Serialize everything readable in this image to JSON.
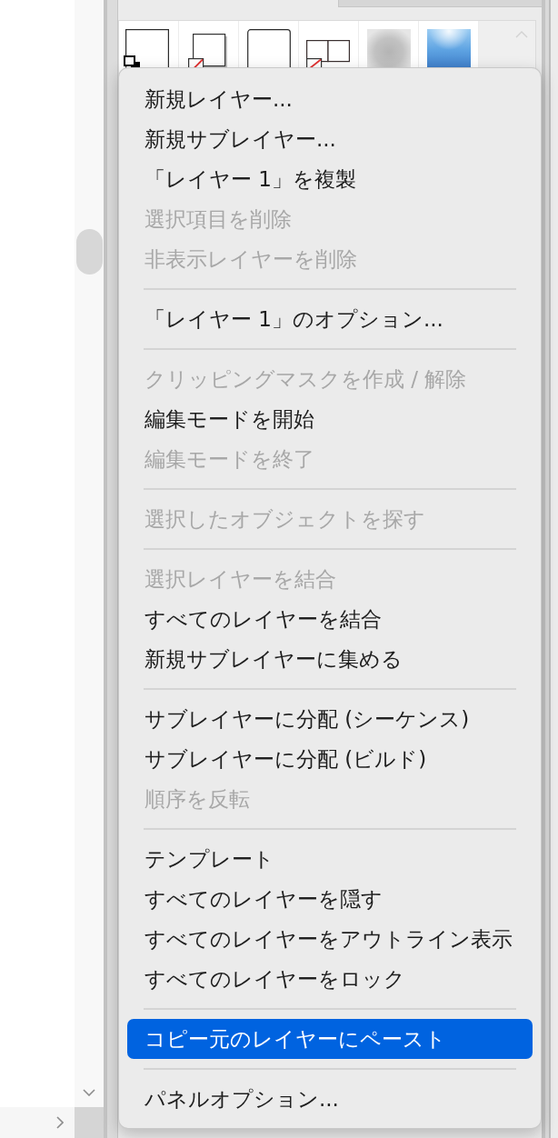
{
  "context_menu": {
    "sections": [
      {
        "items": [
          {
            "label": "新規レイヤー...",
            "disabled": false,
            "selected": false
          },
          {
            "label": "新規サブレイヤー...",
            "disabled": false,
            "selected": false
          },
          {
            "label": "「レイヤー 1」を複製",
            "disabled": false,
            "selected": false
          },
          {
            "label": "選択項目を削除",
            "disabled": true,
            "selected": false
          },
          {
            "label": "非表示レイヤーを削除",
            "disabled": true,
            "selected": false
          }
        ]
      },
      {
        "items": [
          {
            "label": "「レイヤー 1」のオプション...",
            "disabled": false,
            "selected": false
          }
        ]
      },
      {
        "items": [
          {
            "label": "クリッピングマスクを作成 / 解除",
            "disabled": true,
            "selected": false
          },
          {
            "label": "編集モードを開始",
            "disabled": false,
            "selected": false
          },
          {
            "label": "編集モードを終了",
            "disabled": true,
            "selected": false
          }
        ]
      },
      {
        "items": [
          {
            "label": "選択したオブジェクトを探す",
            "disabled": true,
            "selected": false
          }
        ]
      },
      {
        "items": [
          {
            "label": "選択レイヤーを結合",
            "disabled": true,
            "selected": false
          },
          {
            "label": "すべてのレイヤーを結合",
            "disabled": false,
            "selected": false
          },
          {
            "label": "新規サブレイヤーに集める",
            "disabled": false,
            "selected": false
          }
        ]
      },
      {
        "items": [
          {
            "label": "サブレイヤーに分配 (シーケンス)",
            "disabled": false,
            "selected": false
          },
          {
            "label": "サブレイヤーに分配 (ビルド)",
            "disabled": false,
            "selected": false
          },
          {
            "label": "順序を反転",
            "disabled": true,
            "selected": false
          }
        ]
      },
      {
        "items": [
          {
            "label": "テンプレート",
            "disabled": false,
            "selected": false
          },
          {
            "label": "すべてのレイヤーを隠す",
            "disabled": false,
            "selected": false
          },
          {
            "label": "すべてのレイヤーをアウトライン表示",
            "disabled": false,
            "selected": false
          },
          {
            "label": "すべてのレイヤーをロック",
            "disabled": false,
            "selected": false
          }
        ]
      },
      {
        "items": [
          {
            "label": "コピー元のレイヤーにペースト",
            "disabled": false,
            "selected": true
          }
        ]
      },
      {
        "items": [
          {
            "label": "パネルオプション...",
            "disabled": false,
            "selected": false
          }
        ]
      }
    ]
  }
}
